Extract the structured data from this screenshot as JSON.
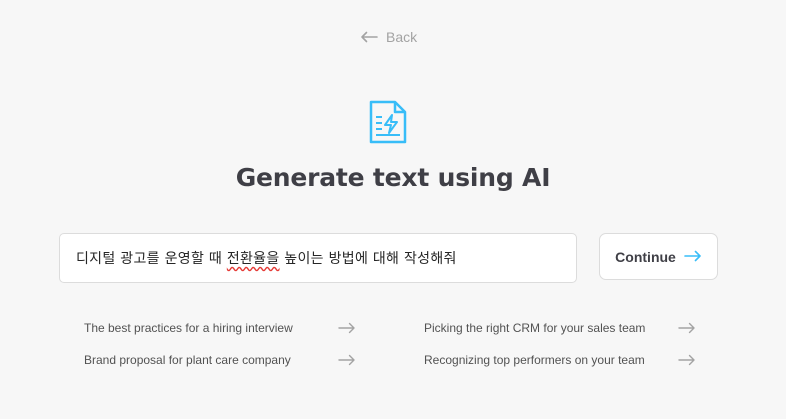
{
  "nav": {
    "back_label": "Back"
  },
  "header": {
    "title": "Generate text using AI"
  },
  "prompt": {
    "part1": "디지털 광고를 운영할 때 ",
    "misspelled": "전환율을",
    "part2": " 높이는 방법에 대해 작성해줘"
  },
  "actions": {
    "continue_label": "Continue"
  },
  "suggestions": [
    "The best practices for a hiring interview",
    "Brand proposal for plant care company",
    "Picking the right CRM for your sales team",
    "Recognizing top performers on your team"
  ],
  "colors": {
    "accent": "#38bdf8",
    "muted": "#a3a3a3",
    "text": "#3f3f46"
  },
  "icons": {
    "doc": "document-lightning-icon",
    "back": "arrow-left-icon",
    "next": "arrow-right-icon"
  }
}
